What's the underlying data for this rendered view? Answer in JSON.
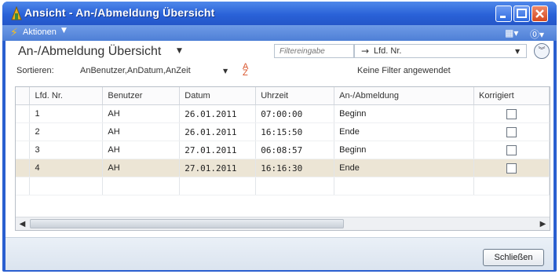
{
  "window": {
    "title": "Ansicht - An-/Abmeldung Übersicht",
    "accent": "#2a62d8"
  },
  "actionbar": {
    "actions_label": "Aktionen",
    "actions_icon": "lightning-icon",
    "menu_icon": "window-menu-icon",
    "help_icon": "help-icon"
  },
  "page": {
    "title": "An-/Abmeldung Übersicht"
  },
  "filter": {
    "placeholder": "Filtereingabe",
    "field": "Lfd. Nr.",
    "status": "Keine Filter angewendet"
  },
  "sort": {
    "label": "Sortieren:",
    "value": "AnBenutzer,AnDatum,AnZeit"
  },
  "table": {
    "headers": [
      "Lfd. Nr.",
      "Benutzer",
      "Datum",
      "Uhrzeit",
      "An-/Abmeldung",
      "Korrigiert"
    ],
    "rows": [
      [
        "1",
        "AH",
        "26.01.2011",
        "07:00:00",
        "Beginn",
        false
      ],
      [
        "2",
        "AH",
        "26.01.2011",
        "16:15:50",
        "Ende",
        false
      ],
      [
        "3",
        "AH",
        "27.01.2011",
        "06:08:57",
        "Beginn",
        false
      ],
      [
        "4",
        "AH",
        "27.01.2011",
        "16:16:30",
        "Ende",
        false
      ]
    ],
    "selected_row": 4
  },
  "footer": {
    "close_label": "Schließen"
  }
}
